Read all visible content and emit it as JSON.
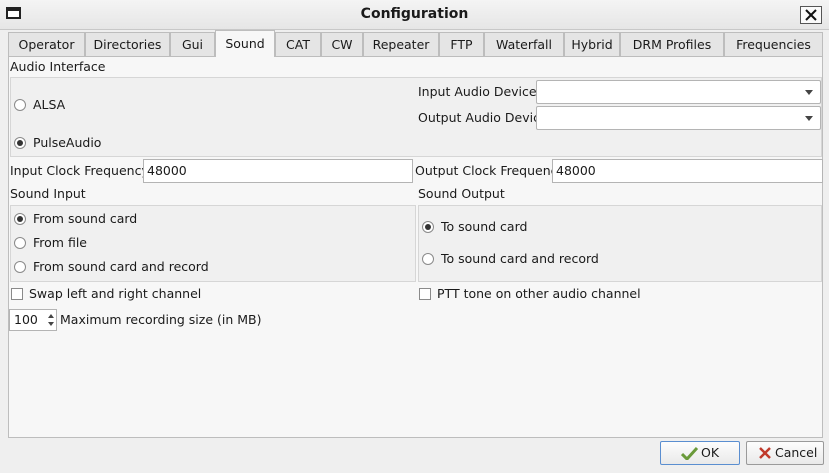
{
  "window": {
    "title": "Configuration"
  },
  "tabs": [
    "Operator",
    "Directories",
    "Gui",
    "Sound",
    "CAT",
    "CW",
    "Repeater",
    "FTP",
    "Waterfall",
    "Hybrid",
    "DRM Profiles",
    "Frequencies"
  ],
  "active_tab": "Sound",
  "audio_interface": {
    "title": "Audio Interface",
    "options": [
      "ALSA",
      "PulseAudio"
    ],
    "selected": "PulseAudio",
    "input_device_label": "Input Audio Device",
    "input_device_value": "",
    "output_device_label": "Output Audio Device",
    "output_device_value": ""
  },
  "clock": {
    "input_label": "Input  Clock Frequency",
    "input_value": "48000",
    "output_label": "Output Clock Frequency",
    "output_value": "48000"
  },
  "sound_input": {
    "title": "Sound Input",
    "options": [
      "From sound card",
      "From file",
      "From sound card and record"
    ],
    "selected": "From sound card"
  },
  "sound_output": {
    "title": "Sound Output",
    "options": [
      "To sound card",
      "To sound card and record"
    ],
    "selected": "To sound card"
  },
  "checks": {
    "swap": "Swap left and right channel",
    "ptt": "PTT tone on other audio channel"
  },
  "recording": {
    "value": "100",
    "label": "Maximum recording size (in MB)"
  },
  "buttons": {
    "ok": "OK",
    "cancel": "Cancel"
  },
  "icons": {
    "window": "window-icon",
    "close": "close-icon",
    "ok": "ok-icon",
    "cancel": "cancel-icon"
  },
  "colors": {
    "ok_icon": "#6a9a3a",
    "cancel_icon": "#c0392b"
  }
}
